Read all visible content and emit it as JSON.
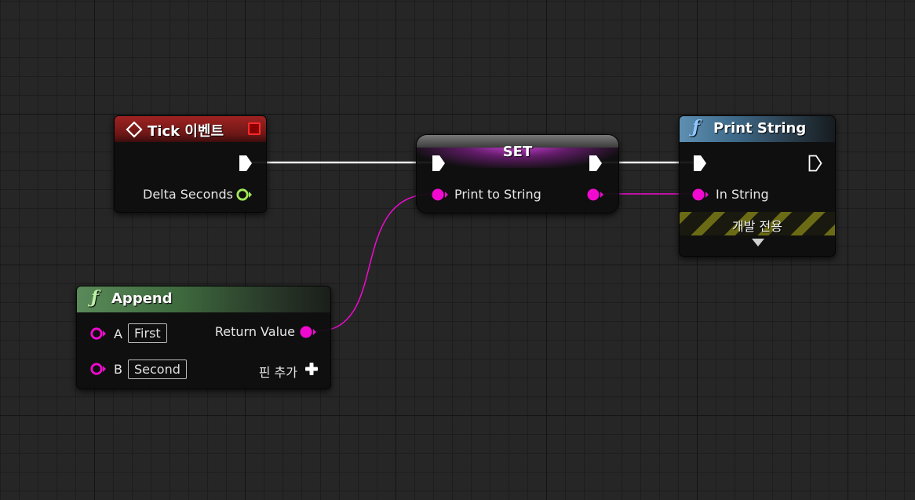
{
  "nodes": {
    "tick": {
      "title": "Tick 이벤트",
      "pins": {
        "delta_seconds": "Delta Seconds"
      }
    },
    "set": {
      "title": "SET",
      "pins": {
        "print_to_string": "Print to String"
      }
    },
    "print_string": {
      "title": "Print String",
      "pins": {
        "in_string": "In String"
      },
      "dev_only": "개발 전용"
    },
    "append": {
      "title": "Append",
      "pins": {
        "a": "A",
        "a_value": "First",
        "b": "B",
        "b_value": "Second",
        "return_value": "Return Value",
        "add_pin": "핀 추가"
      }
    }
  },
  "colors": {
    "exec": "#ffffff",
    "string": "#f00ad0",
    "float": "#a0e85a",
    "tick_header": "#9f2322",
    "function_header": "#5e8fb1",
    "pure_header": "#5a8a59",
    "variable_header": "#c84cd2"
  },
  "icons": [
    "event-diamond-icon",
    "event-stop-icon",
    "function-icon",
    "exec-pin-icon",
    "data-pin-icon",
    "expand-arrow-icon",
    "add-pin-plus-icon"
  ]
}
